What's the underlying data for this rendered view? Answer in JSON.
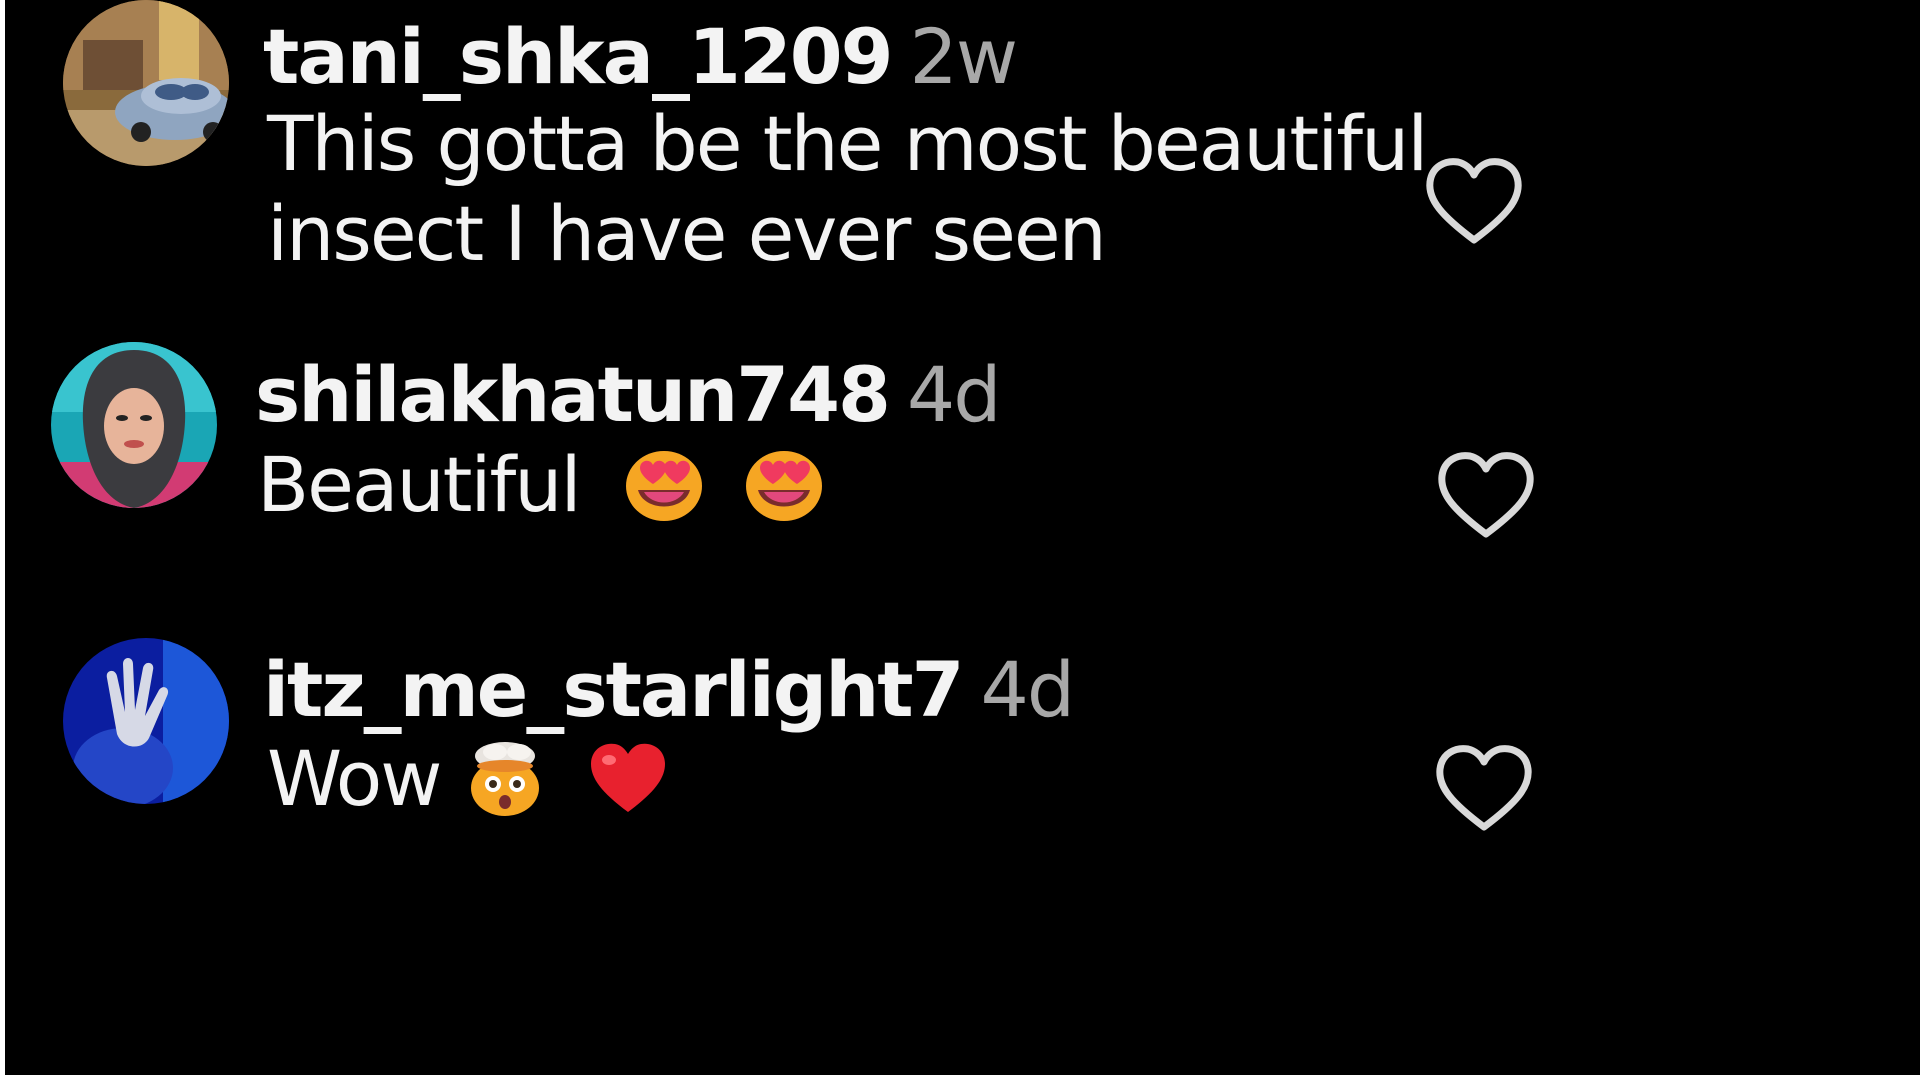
{
  "comments": [
    {
      "username": "tani_shka_1209",
      "time": "2w",
      "text_line1": "This gotta be the most beautiful",
      "text_line2": "insect I have ever seen",
      "avatar": "profile-photo-car-cartoon",
      "like_icon": "heart-outline-icon"
    },
    {
      "username": "shilakhatun748",
      "time": "4d",
      "text": "Beautiful",
      "emojis": [
        "heart-eyes-emoji",
        "heart-eyes-emoji"
      ],
      "avatar": "profile-photo-woman-hijab",
      "like_icon": "heart-outline-icon"
    },
    {
      "username": "itz_me_starlight7",
      "time": "4d",
      "text": "Wow",
      "emojis": [
        "exploding-head-emoji",
        "red-heart-emoji"
      ],
      "avatar": "profile-photo-gloved-hand-blue",
      "like_icon": "heart-outline-icon"
    }
  ],
  "colors": {
    "background": "#000000",
    "username": "#f3f3f3",
    "timestamp": "#a8a8a8",
    "icon": "#d9d9d9"
  }
}
